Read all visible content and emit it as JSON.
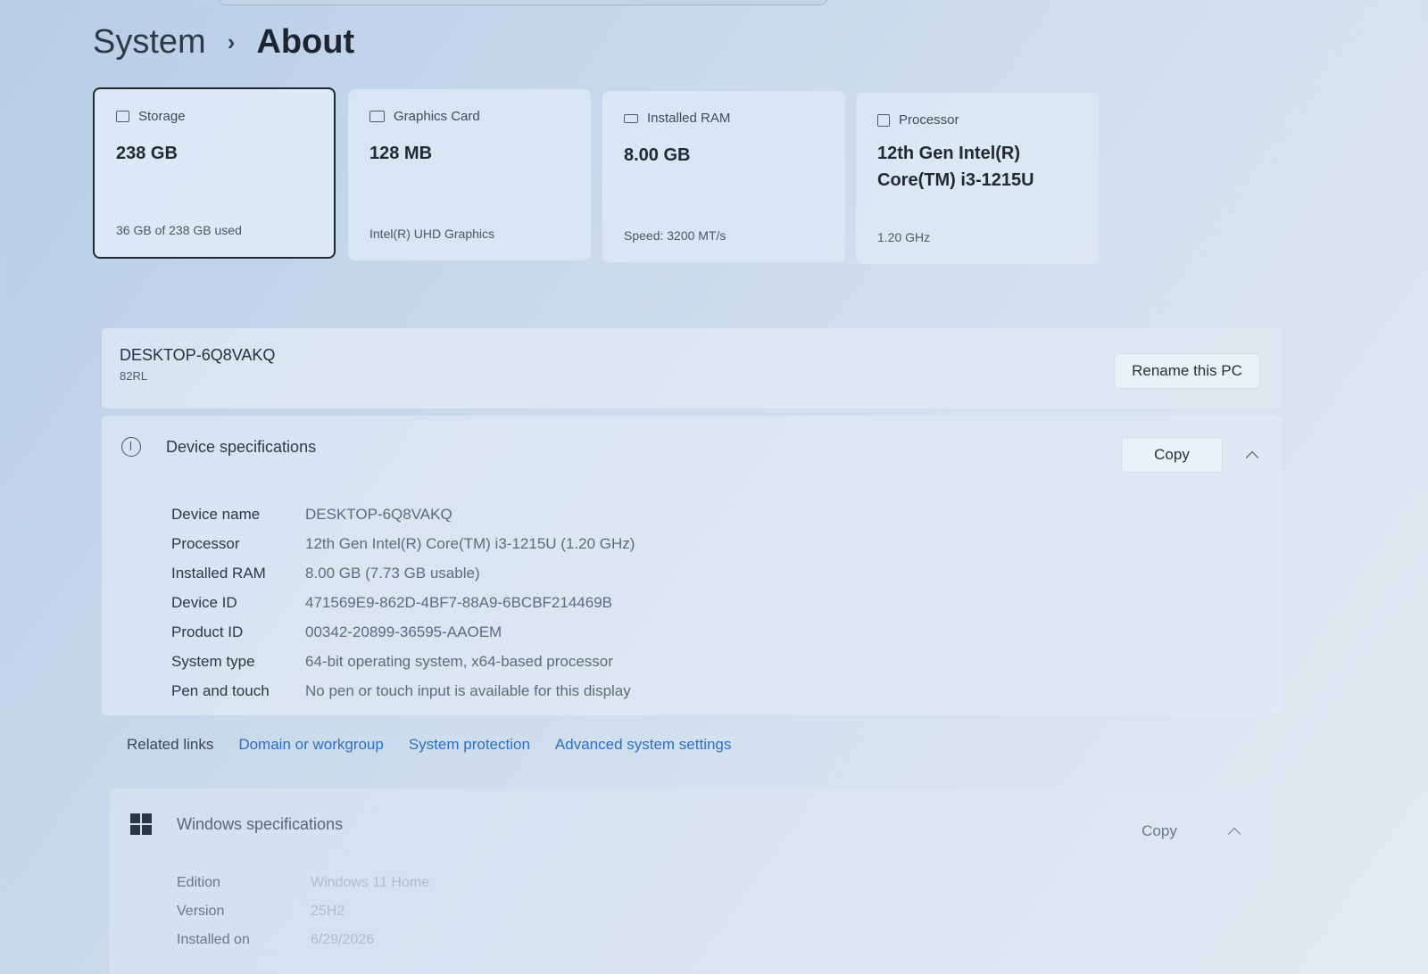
{
  "breadcrumb": {
    "parent": "System",
    "separator": "›",
    "current": "About"
  },
  "cards": [
    {
      "label": "Storage",
      "value": "238 GB",
      "sub": "36 GB of 238 GB used"
    },
    {
      "label": "Graphics Card",
      "value": "128 MB",
      "sub": "Intel(R) UHD Graphics"
    },
    {
      "label": "Installed RAM",
      "value": "8.00 GB",
      "sub": "Speed: 3200 MT/s"
    },
    {
      "label": "Processor",
      "value_line1": "12th Gen Intel(R)",
      "value_line2": "Core(TM) i3-1215U",
      "sub": "1.20 GHz"
    }
  ],
  "pc": {
    "name": "DESKTOP-6Q8VAKQ",
    "model": "82RL",
    "rename_label": "Rename this PC"
  },
  "device_specs": {
    "title": "Device specifications",
    "copy_label": "Copy",
    "rows": [
      {
        "k": "Device name",
        "v": "DESKTOP-6Q8VAKQ"
      },
      {
        "k": "Processor",
        "v": "12th Gen Intel(R) Core(TM) i3-1215U (1.20 GHz)"
      },
      {
        "k": "Installed RAM",
        "v": "8.00 GB (7.73 GB usable)"
      },
      {
        "k": "Device ID",
        "v": "471569E9-862D-4BF7-88A9-6BCBF214469B"
      },
      {
        "k": "Product ID",
        "v": "00342-20899-36595-AAOEM"
      },
      {
        "k": "System type",
        "v": "64-bit operating system, x64-based processor"
      },
      {
        "k": "Pen and touch",
        "v": "No pen or touch input is available for this display"
      }
    ]
  },
  "related": {
    "label": "Related links",
    "links": [
      "Domain or workgroup",
      "System protection",
      "Advanced system settings"
    ]
  },
  "windows_specs": {
    "title": "Windows specifications",
    "copy_label": "Copy",
    "rows": [
      {
        "k": "Edition",
        "v": "Windows 11 Home"
      },
      {
        "k": "Version",
        "v": "25H2"
      },
      {
        "k": "Installed on",
        "v": "6/29/2026"
      }
    ]
  }
}
